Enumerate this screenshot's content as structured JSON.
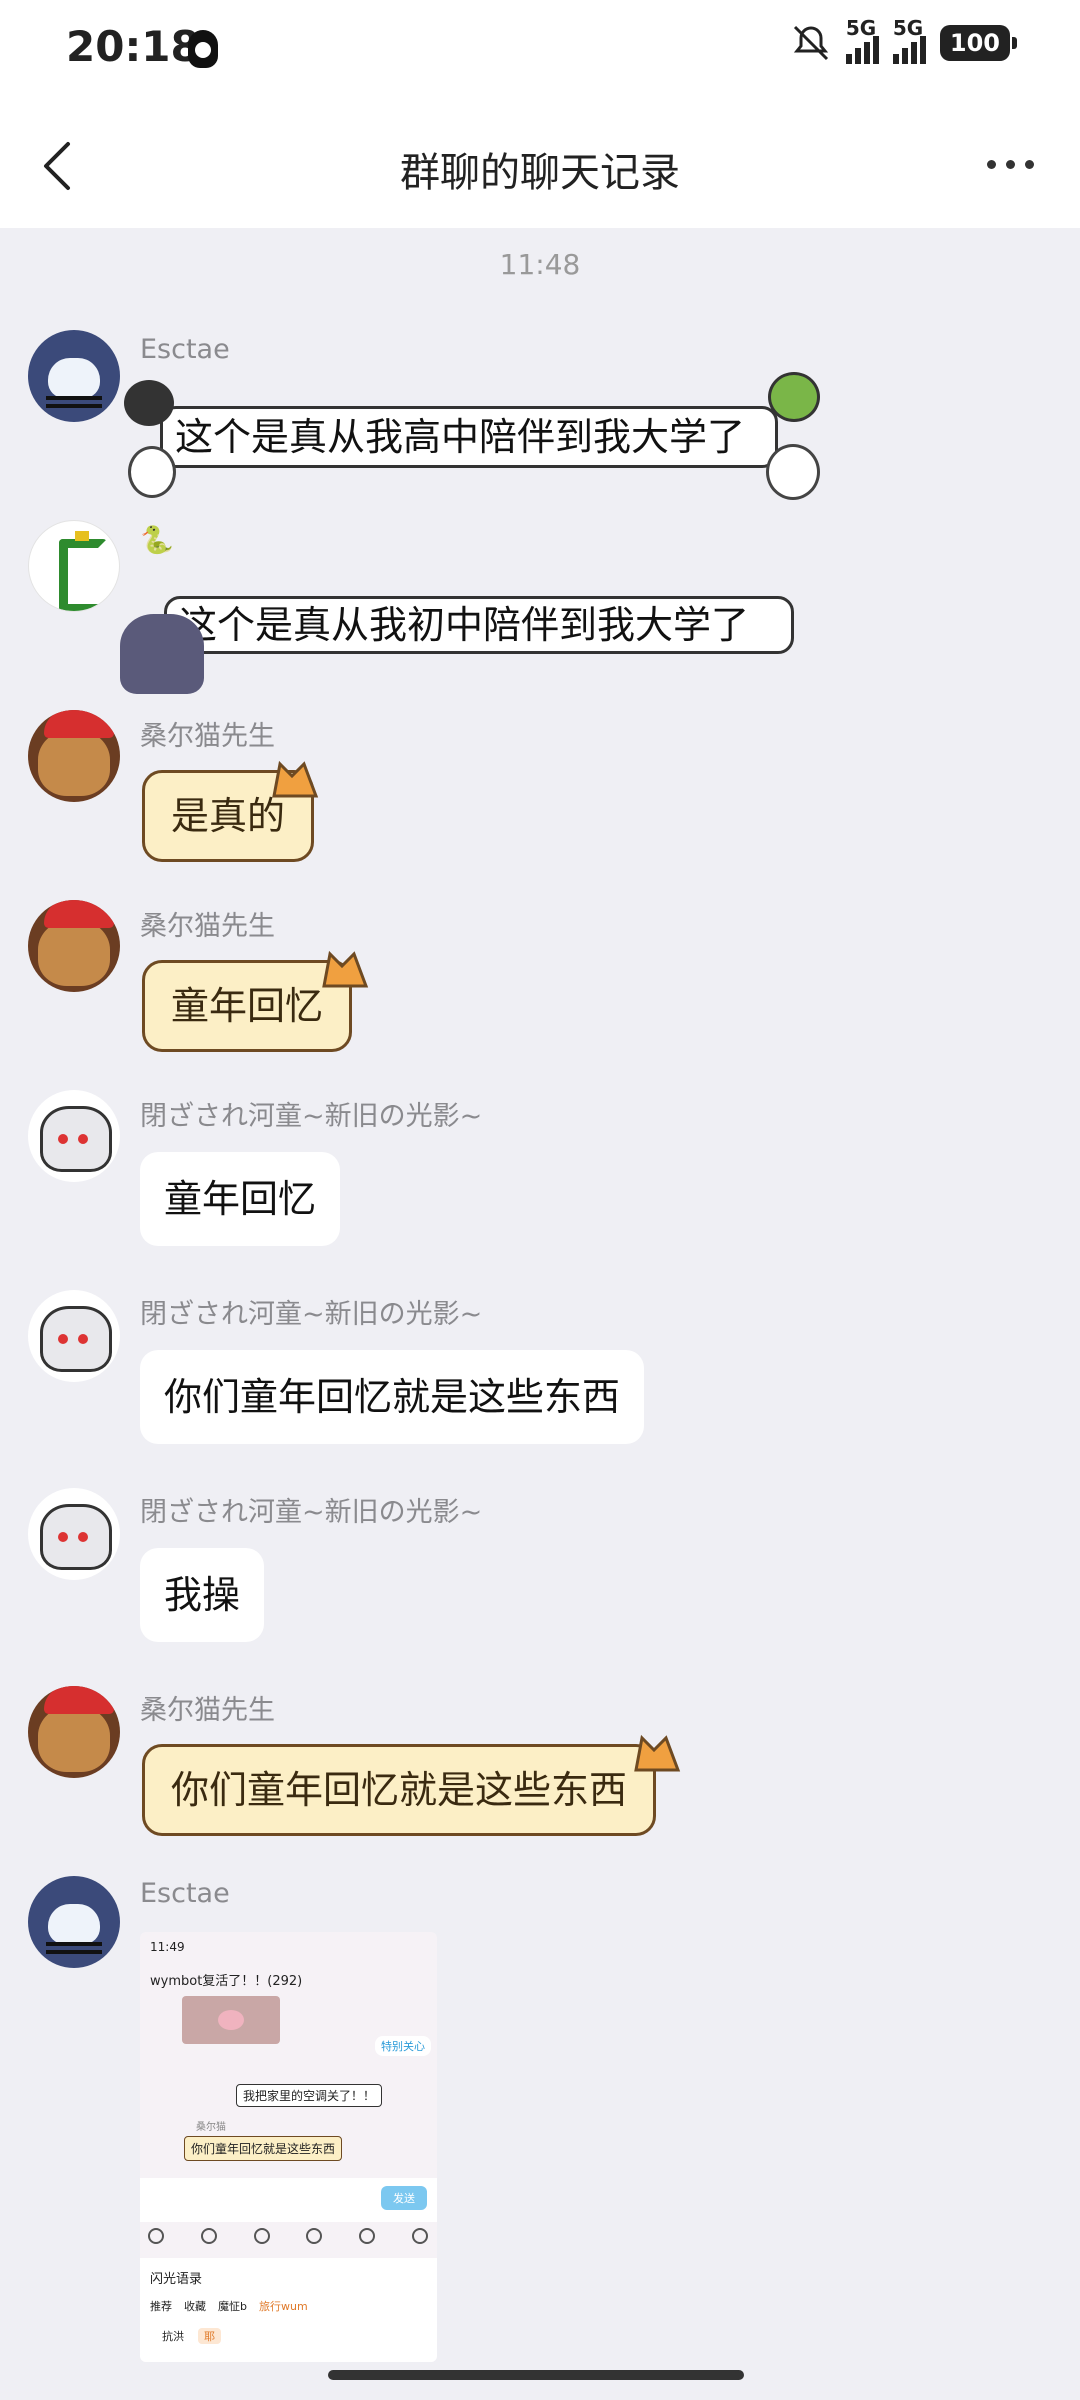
{
  "status_bar": {
    "time": "20:18",
    "network_1": "5G",
    "network_2": "5G",
    "battery": "100"
  },
  "nav": {
    "title": "群聊的聊天记录"
  },
  "chat": {
    "timestamp": "11:48",
    "messages": [
      {
        "sender": "Esctae",
        "text": "这个是真从我高中陪伴到我大学了"
      },
      {
        "sender": "🐍",
        "text": "这个是真从我初中陪伴到我大学了"
      },
      {
        "sender": "桑尔猫先生",
        "text": "是真的"
      },
      {
        "sender": "桑尔猫先生",
        "text": "童年回忆"
      },
      {
        "sender": "閉ざされ河童~新旧の光影~",
        "text": "童年回忆"
      },
      {
        "sender": "閉ざされ河童~新旧の光影~",
        "text": "你们童年回忆就是这些东西"
      },
      {
        "sender": "閉ざされ河童~新旧の光影~",
        "text": "我操"
      },
      {
        "sender": "桑尔猫先生",
        "text": "你们童年回忆就是这些东西"
      },
      {
        "sender": "Esctae",
        "text": ""
      }
    ]
  },
  "screenshot": {
    "time": "11:49",
    "title": "wymbot复活了！！(292)",
    "follow_label": "特别关心",
    "msg_1": "我把家里的空调关了！！",
    "sender_2": "桑尔猫",
    "msg_2": "你们童年回忆就是这些东西",
    "send_label": "发送",
    "panel_title": "闪光语录",
    "tabs": [
      "推荐",
      "收藏",
      "魔怔b",
      "旅行wum"
    ],
    "row": [
      "抗洪",
      "耶"
    ]
  }
}
